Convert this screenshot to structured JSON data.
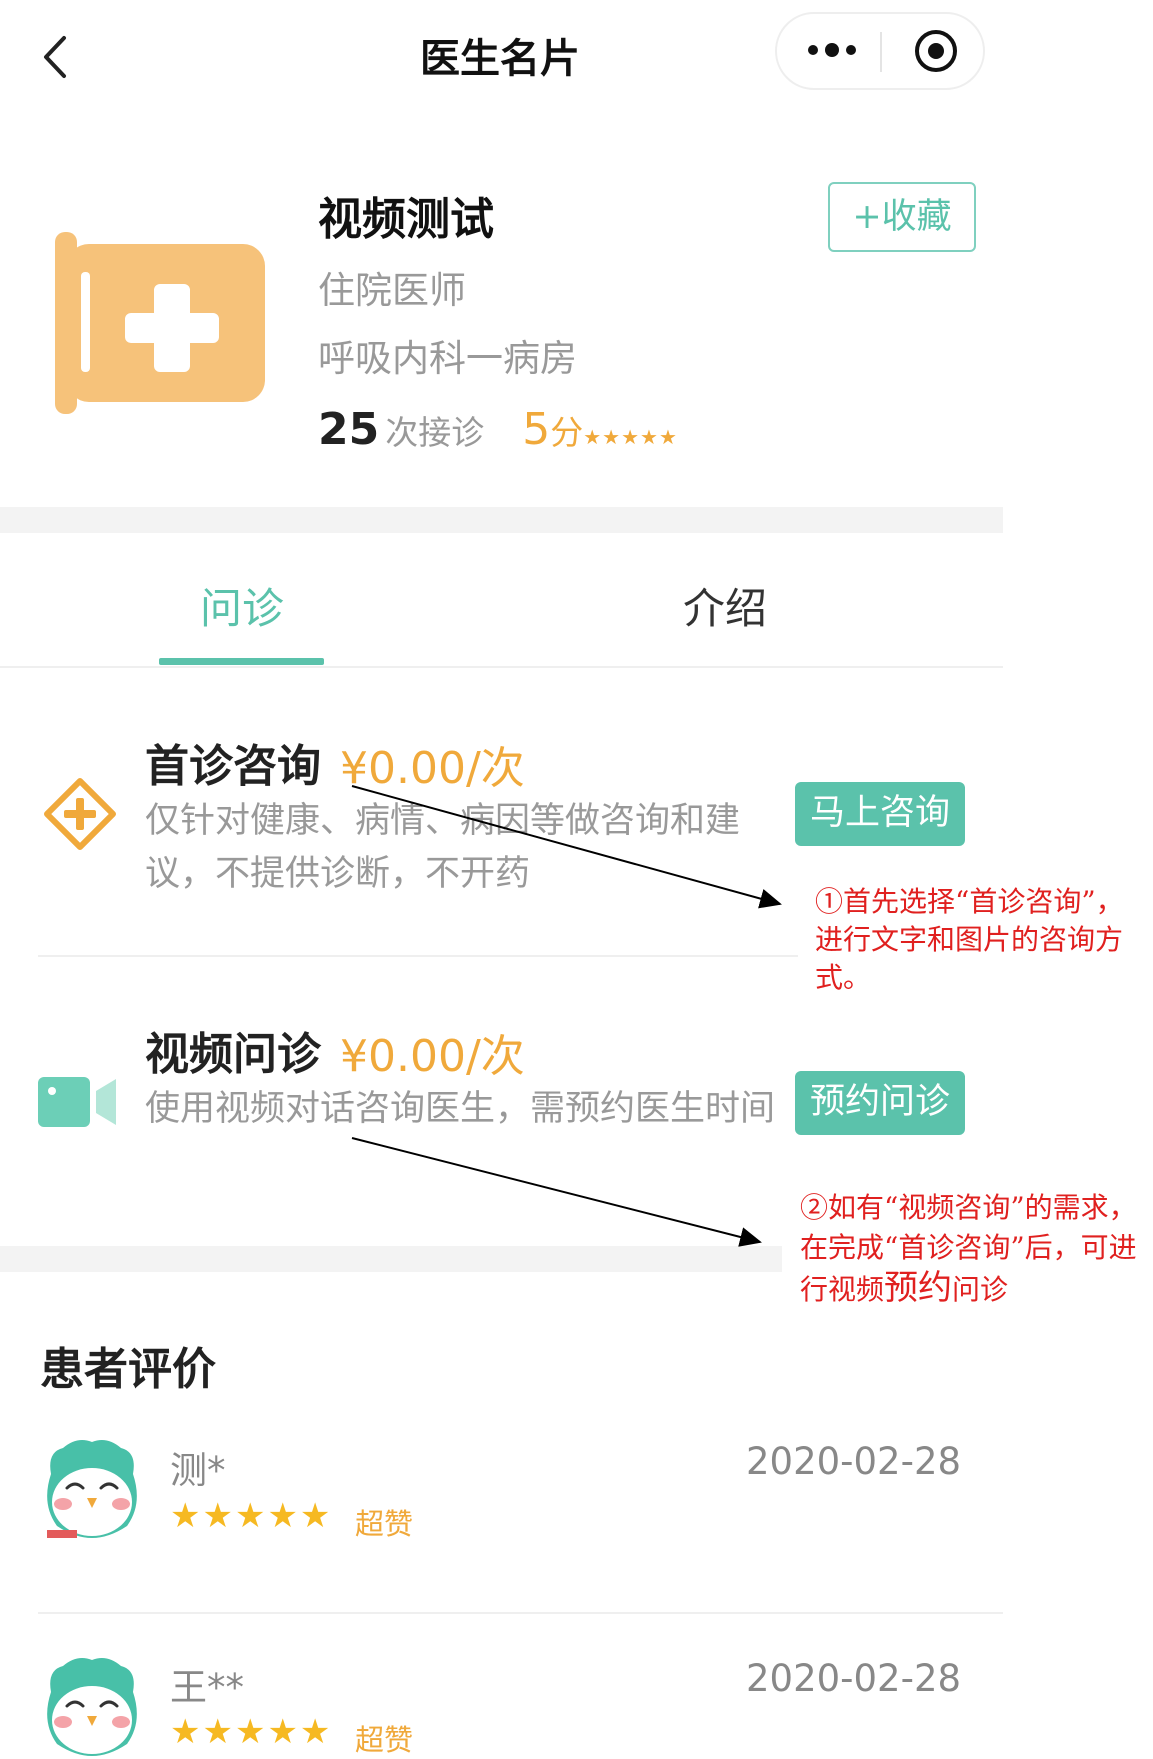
{
  "nav": {
    "title": "医生名片",
    "more_icon": "more-dots-icon",
    "close_icon": "target-circle-icon",
    "back_icon": "chevron-left-icon"
  },
  "doctor": {
    "name": "视频测试",
    "title": "住院医师",
    "department": "呼吸内科一病房",
    "visits": "25",
    "visits_label": "次接诊",
    "rating": "5",
    "rating_unit": "分",
    "rating_stars": "★★★★★",
    "rating_value": 5,
    "favorite_label": "+收藏",
    "avatar_icon": "medical-kit-icon"
  },
  "tabs": [
    {
      "label": "问诊",
      "active": true
    },
    {
      "label": "介绍",
      "active": false
    }
  ],
  "services": [
    {
      "title": "首诊咨询",
      "price": "¥0.00/次",
      "description": "仅针对健康、病情、病因等做咨询和建议，不提供诊断，不开药",
      "button": "马上咨询",
      "icon": "plus-diamond-icon"
    },
    {
      "title": "视频问诊",
      "price": "¥0.00/次",
      "description": "使用视频对话咨询医生，需预约医生时间",
      "button": "预约问诊",
      "icon": "video-camera-icon"
    }
  ],
  "annotations": {
    "note1": "①首先选择“首诊咨询”，进行文字和图片的咨询方式。",
    "note2_part1": "②如有“视频咨询”的需求，在完成“首诊咨询”后，可进行视频",
    "note2_emph": "预约",
    "note2_part2": "问诊"
  },
  "reviews": {
    "title": "患者评价",
    "items": [
      {
        "name": "测*",
        "date": "2020-02-28",
        "stars": "★★★★★",
        "rating": 5,
        "level": "超赞",
        "avatar": "owl-avatar-icon"
      },
      {
        "name": "王**",
        "date": "2020-02-28",
        "stars": "★★★★★",
        "rating": 5,
        "level": "超赞",
        "avatar": "owl-avatar-icon"
      }
    ]
  },
  "colors": {
    "accent": "#5bc2ab",
    "price": "#f0a93b",
    "annotation": "#e0201f",
    "icon_orange": "#f6c27a"
  }
}
